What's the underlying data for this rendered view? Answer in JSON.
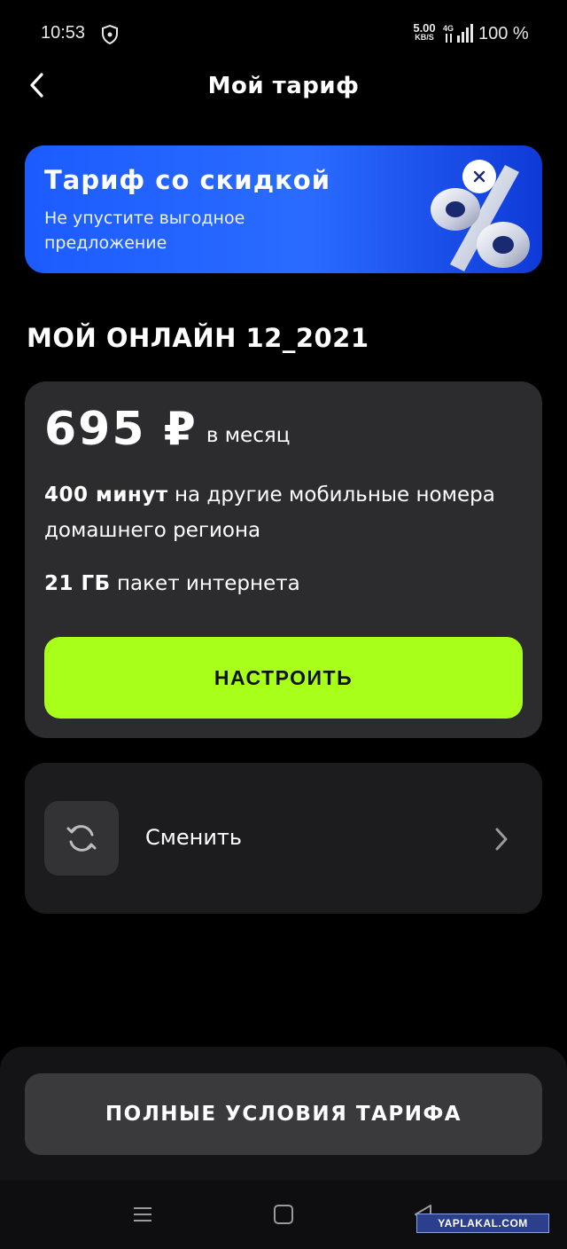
{
  "status_bar": {
    "time": "10:53",
    "net_speed_value": "5.00",
    "net_speed_unit": "KB/S",
    "network_type": "4G",
    "battery": "100 %"
  },
  "header": {
    "title": "Мой тариф"
  },
  "promo": {
    "title": "Тариф со скидкой",
    "subtitle": "Не упустите выгодное предложение",
    "accent_color": "#2a6bff"
  },
  "tariff": {
    "name": "МОЙ ОНЛАЙН 12_2021",
    "price": "695 ₽",
    "period": "в месяц",
    "features": [
      {
        "bold": "400 минут",
        "text": "на другие мобильные номера домашнего региона"
      },
      {
        "bold": "21 ГБ",
        "text": "пакет интернета"
      }
    ],
    "configure_label": "НАСТРОИТЬ",
    "configure_color": "#a8ff1a"
  },
  "change": {
    "label": "Сменить",
    "icon": "refresh-icon"
  },
  "bottom": {
    "full_terms_label": "ПОЛНЫЕ УСЛОВИЯ ТАРИФА"
  },
  "watermark": "YAPLAKAL.COM"
}
